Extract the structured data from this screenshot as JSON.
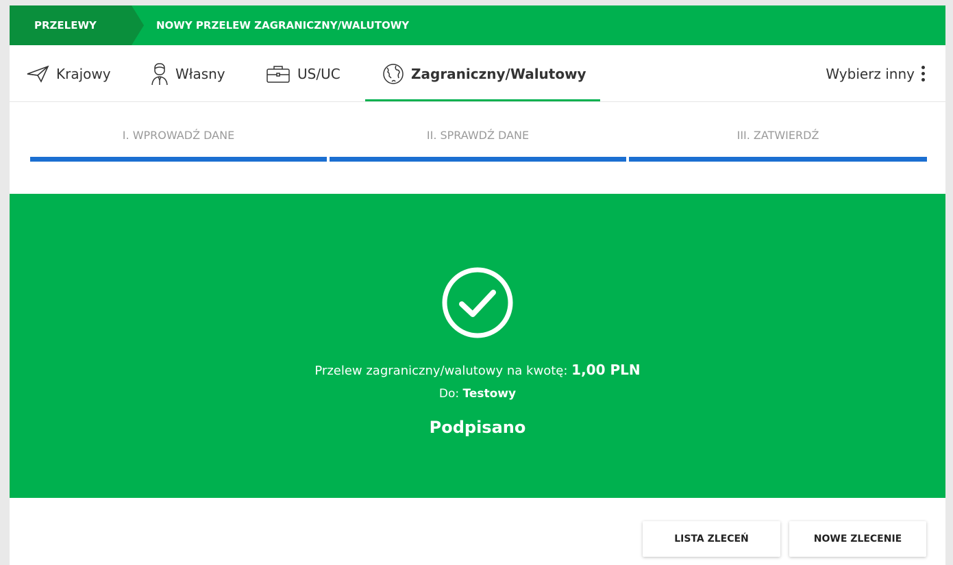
{
  "breadcrumb": {
    "first": "PRZELEWY",
    "second": "NOWY PRZELEW ZAGRANICZNY/WALUTOWY"
  },
  "tabs": [
    {
      "label": "Krajowy",
      "icon": "paper-plane-icon"
    },
    {
      "label": "Własny",
      "icon": "person-icon"
    },
    {
      "label": "US/UC",
      "icon": "briefcase-icon"
    },
    {
      "label": "Zagraniczny/Walutowy",
      "icon": "globe-icon",
      "active": true
    }
  ],
  "choose_other": "Wybierz inny",
  "steps": [
    {
      "label": "I. WPROWADŹ DANE"
    },
    {
      "label": "II. SPRAWDŹ DANE"
    },
    {
      "label": "III. ZATWIERDŹ"
    }
  ],
  "result": {
    "amount_prefix": "Przelew zagraniczny/walutowy na kwotę:",
    "amount": "1,00 PLN",
    "to_prefix": "Do:",
    "to_name": "Testowy",
    "status": "Podpisano"
  },
  "buttons": {
    "list": "LISTA ZLECEŃ",
    "new": "NOWE ZLECENIE"
  },
  "colors": {
    "brand_green": "#00b14f",
    "dark_green": "#0a8f3c",
    "step_blue": "#1b6fd1"
  }
}
